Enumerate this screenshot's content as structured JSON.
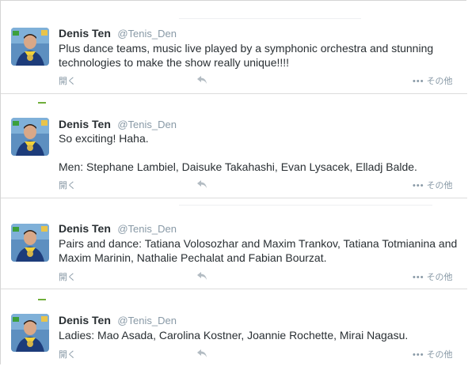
{
  "tweets": [
    {
      "name": "Denis Ten",
      "handle": "@Tenis_Den",
      "text_lines": [
        "Plus dance teams, music live played by a symphonic orchestra and stunning technologies to make the show really unique!!!!"
      ],
      "expand_label": "開く",
      "more_label": "その他"
    },
    {
      "name": "Denis Ten",
      "handle": "@Tenis_Den",
      "text_lines": [
        "So exciting! Haha.",
        "",
        "Men: Stephane Lambiel, Daisuke Takahashi, Evan Lysacek, Elladj Balde."
      ],
      "expand_label": "開く",
      "more_label": "その他"
    },
    {
      "name": "Denis Ten",
      "handle": "@Tenis_Den",
      "text_lines": [
        "Pairs and dance: Tatiana Volosozhar and Maxim Trankov, Tatiana Totmianina and Maxim Marinin, Nathalie Pechalat and Fabian Bourzat."
      ],
      "expand_label": "開く",
      "more_label": "その他"
    },
    {
      "name": "Denis Ten",
      "handle": "@Tenis_Den",
      "text_lines": [
        "Ladies: Mao Asada, Carolina Kostner, Joannie Rochette, Mirai Nagasu."
      ],
      "expand_label": "開く",
      "more_label": "その他"
    }
  ],
  "colors": {
    "text": "#292f33",
    "secondary": "#8899a6",
    "divider": "#dcdcdc"
  },
  "icons": {
    "reply": "reply-icon",
    "more": "more-dots-icon",
    "avatar": "avatar"
  }
}
